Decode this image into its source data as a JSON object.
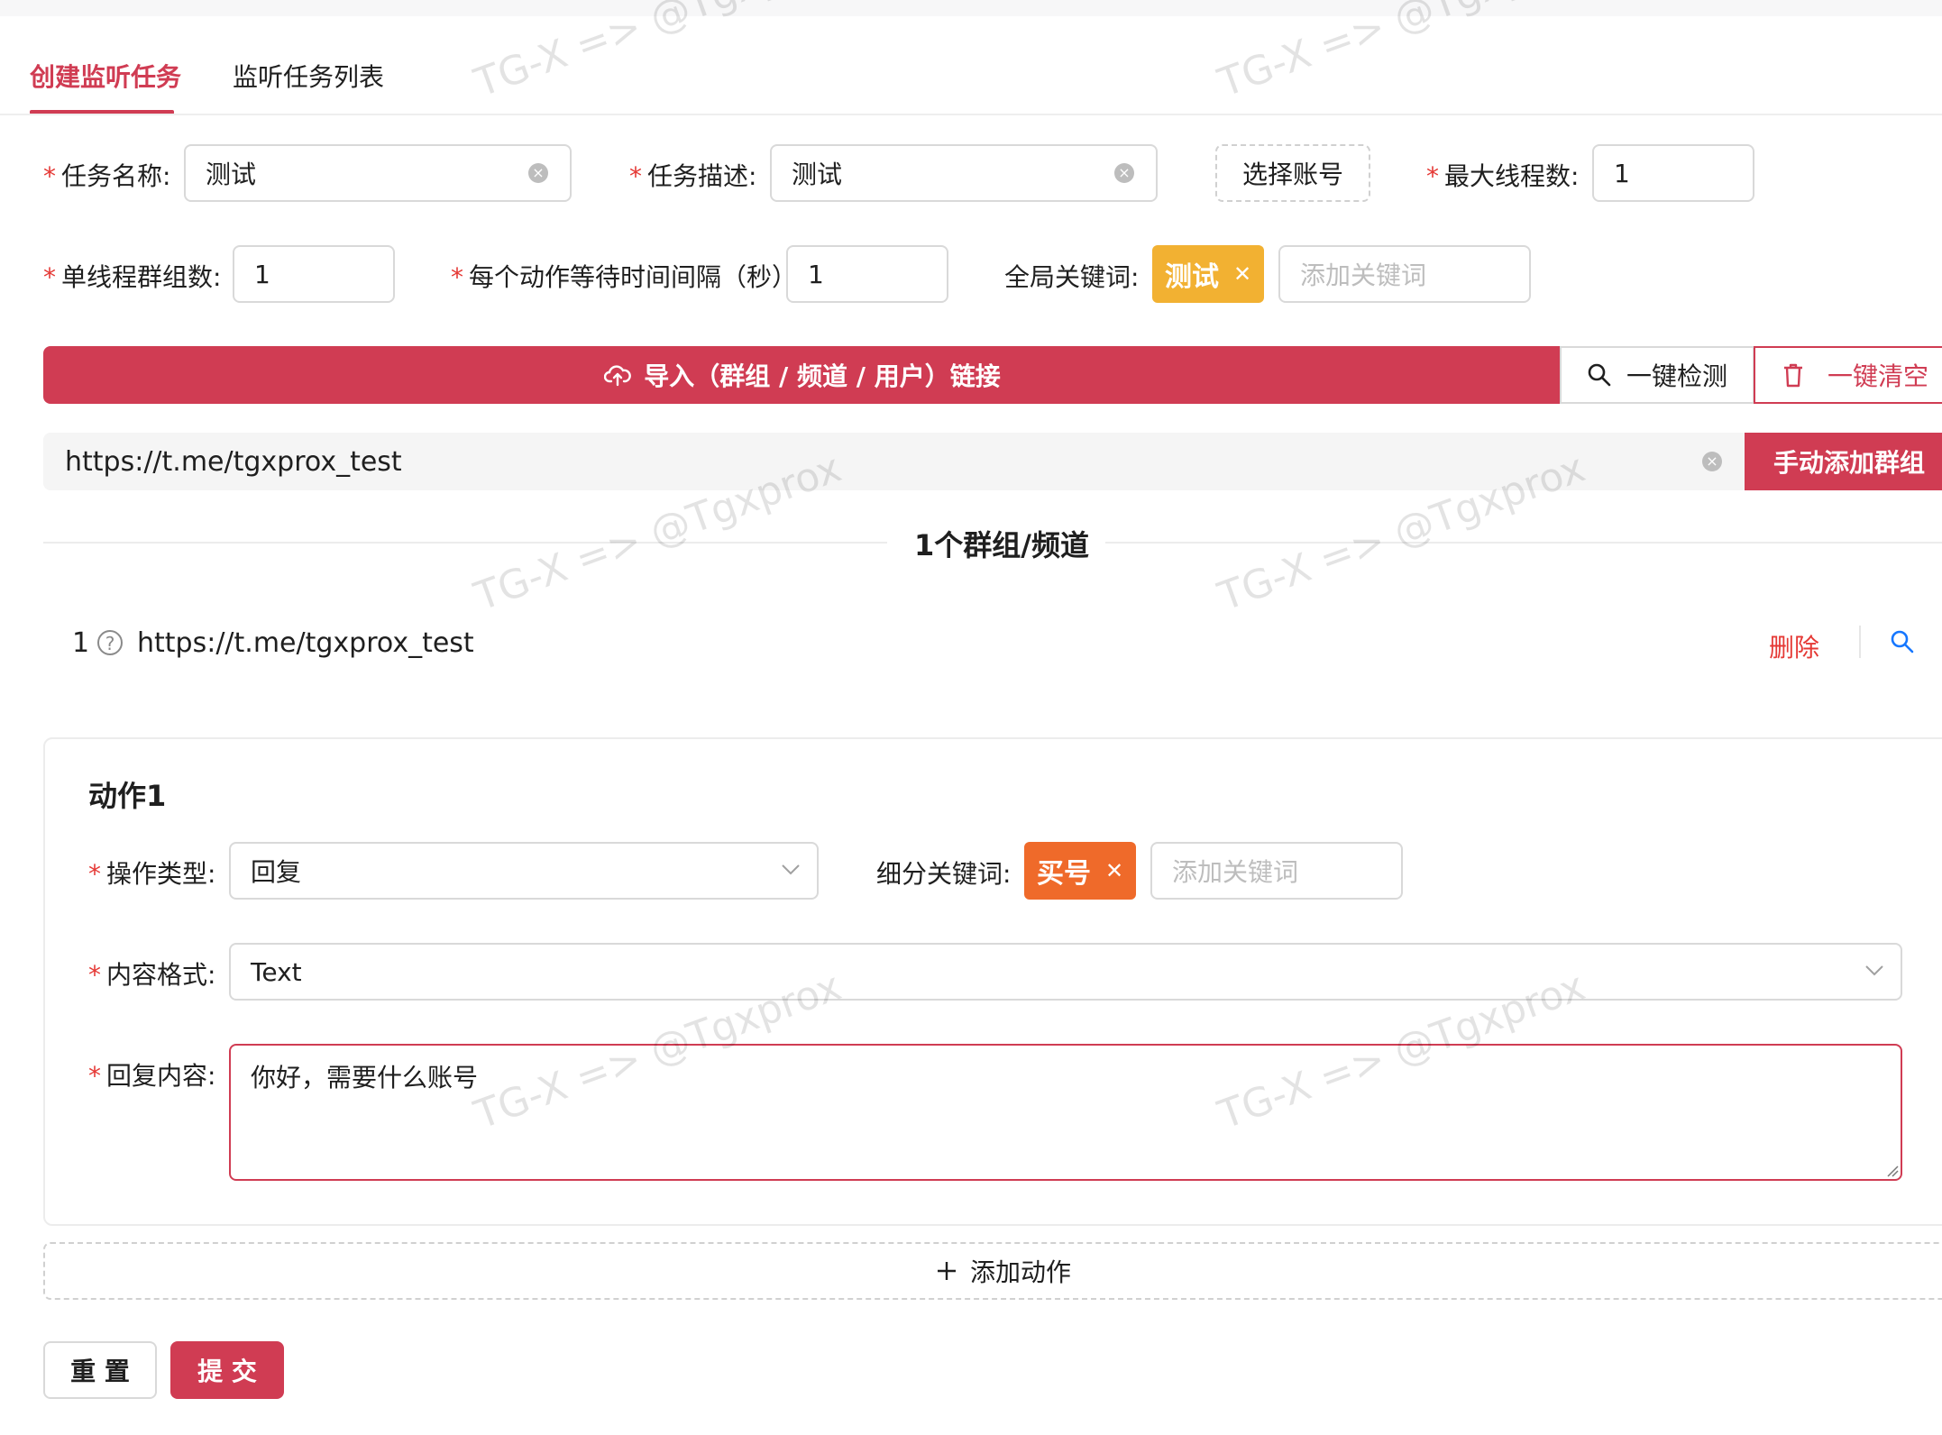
{
  "tabs": [
    {
      "label": "创建监听任务"
    },
    {
      "label": "监听任务列表"
    }
  ],
  "form": {
    "task_name": {
      "label": "任务名称:",
      "value": "测试"
    },
    "task_desc": {
      "label": "任务描述:",
      "value": "测试"
    },
    "select_account_label": "选择账号",
    "max_threads": {
      "label": "最大线程数:",
      "value": "1"
    },
    "groups_per_thread": {
      "label": "单线程群组数:",
      "value": "1"
    },
    "action_interval": {
      "label": "每个动作等待时间间隔（秒）:",
      "value": "1"
    },
    "global_keywords": {
      "label": "全局关键词:",
      "tags": [
        "测试"
      ],
      "placeholder": "添加关键词"
    }
  },
  "import_bar": {
    "import_label": "导入（群组 / 频道 / 用户）链接",
    "check_label": "一键检测",
    "clear_label": "一键清空"
  },
  "manual_add": {
    "url_value": "https://t.me/tgxprox_test",
    "button_label": "手动添加群组"
  },
  "group_list": {
    "divider_label": "1个群组/频道",
    "items": [
      {
        "index": "1",
        "url": "https://t.me/tgxprox_test",
        "delete_label": "删除"
      }
    ]
  },
  "actions": [
    {
      "title": "动作1",
      "op_type": {
        "label": "操作类型:",
        "value": "回复"
      },
      "sub_keywords": {
        "label": "细分关键词:",
        "tags": [
          "买号"
        ],
        "placeholder": "添加关键词"
      },
      "content_format": {
        "label": "内容格式:",
        "value": "Text"
      },
      "reply_content": {
        "label": "回复内容:",
        "value": "你好，需要什么账号"
      }
    }
  ],
  "add_action_label": "添加动作",
  "footer": {
    "reset_label": "重 置",
    "submit_label": "提 交"
  },
  "watermark": "TG-X => @Tgxprox",
  "colors": {
    "primary": "#d03c53",
    "tag_yellow": "#f2b132",
    "tag_orange": "#ef6a2a",
    "required": "#e53935",
    "link_blue": "#1677ff"
  },
  "icons": [
    "clear-icon",
    "cloud-upload-icon",
    "search-icon",
    "trash-icon",
    "help-circle-icon",
    "chevron-down-icon",
    "plus-icon",
    "close-icon",
    "resize-handle-icon"
  ]
}
